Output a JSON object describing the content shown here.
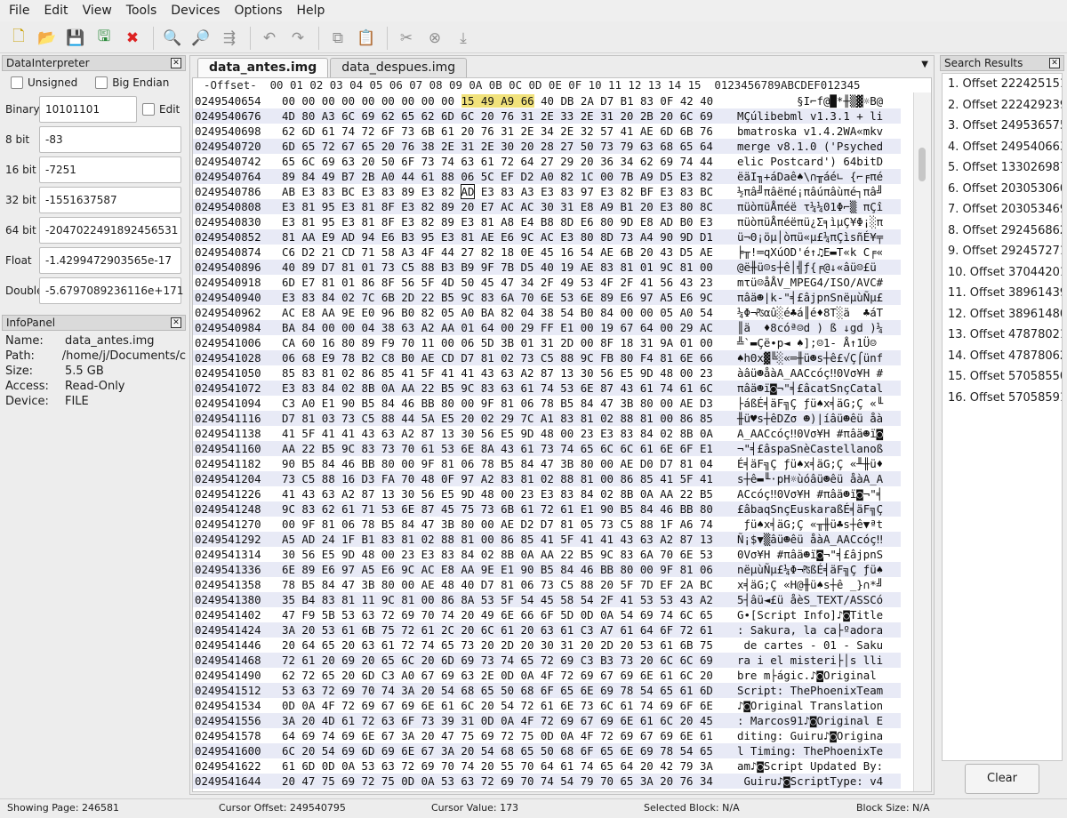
{
  "menu": [
    "File",
    "Edit",
    "View",
    "Tools",
    "Devices",
    "Options",
    "Help"
  ],
  "toolbar_icons": [
    "new-file-icon",
    "open-file-icon",
    "save-icon",
    "save-as-icon",
    "close-file-icon",
    "search-icon",
    "search-replace-icon",
    "goto-icon",
    "undo-icon",
    "redo-icon",
    "copy-icon",
    "paste-icon",
    "cut-icon",
    "delete-icon",
    "insert-icon"
  ],
  "data_interpreter": {
    "title": "DataInterpreter",
    "unsigned_label": "Unsigned",
    "big_endian_label": "Big Endian",
    "edit_label": "Edit",
    "binary_label": "Binary",
    "binary_value": "10101101",
    "bit8_label": "8 bit",
    "bit8_value": "-83",
    "bit16_label": "16 bit",
    "bit16_value": "-7251",
    "bit32_label": "32 bit",
    "bit32_value": "-1551637587",
    "bit64_label": "64 bit",
    "bit64_value": "-2047022491892456531",
    "float_label": "Float",
    "float_value": "-1.4299472903565e-17",
    "double_label": "Double",
    "double_value": "-5.6797089236116e+171"
  },
  "info_panel": {
    "title": "InfoPanel",
    "rows": [
      {
        "k": "Name:",
        "v": "data_antes.img"
      },
      {
        "k": "Path:",
        "v": "/home/j/Documents/c"
      },
      {
        "k": "Size:",
        "v": "5.5 GB"
      },
      {
        "k": "Access:",
        "v": "Read-Only"
      },
      {
        "k": "Device:",
        "v": "FILE"
      }
    ]
  },
  "tabs": [
    "data_antes.img",
    "data_despues.img"
  ],
  "hex": {
    "header": "-Offset-  00 01 02 03 04 05 06 07 08 09 0A 0B 0C 0D 0E 0F 10 11 12 13 14 15  0123456789ABCDEF012345",
    "rows": [
      {
        "o": "0249540654",
        "h": "00 00 00 00 00 00 00 00 00 15 49 A9 66 40 DB 2A D7 B1 83 0F 42 40",
        "a": "         §I⌐f@█*╫▒▓☼B@"
      },
      {
        "o": "0249540676",
        "h": "4D 80 A3 6C 69 62 65 62 6D 6C 20 76 31 2E 33 2E 31 20 2B 20 6C 69",
        "a": "MÇúlibebml v1.3.1 + li"
      },
      {
        "o": "0249540698",
        "h": "62 6D 61 74 72 6F 73 6B 61 20 76 31 2E 34 2E 32 57 41 AE 6D 6B 76",
        "a": "bmatroska v1.4.2WA«mkv"
      },
      {
        "o": "0249540720",
        "h": "6D 65 72 67 65 20 76 38 2E 31 2E 30 20 28 27 50 73 79 63 68 65 64",
        "a": "merge v8.1.0 ('Psyched"
      },
      {
        "o": "0249540742",
        "h": "65 6C 69 63 20 50 6F 73 74 63 61 72 64 27 29 20 36 34 62 69 74 44",
        "a": "elic Postcard') 64bitD"
      },
      {
        "o": "0249540764",
        "h": "89 84 49 B7 2B A0 44 61 88 06 5C EF D2 A0 82 1C 00 7B A9 D5 E3 82",
        "a": "ëäI╖+áDaê♠\\∩╥áé∟ {⌐╒πé"
      },
      {
        "o": "0249540786",
        "h": "AB E3 83 BC E3 83 89 E3 82 AD E3 83 A3 E3 83 97 E3 82 BF E3 83 BC",
        "a": "½πâ╝πâëπé¡πâúπâùπé┐πâ╝"
      },
      {
        "o": "0249540808",
        "h": "E3 81 95 E3 81 8F E3 82 89 20 E7 AC AC 30 31 E8 A9 B1 20 E3 80 8C",
        "a": "πüòπüÅπéë τ¼¼01Φ⌐▒ πÇî"
      },
      {
        "o": "0249540830",
        "h": "E3 81 95 E3 81 8F E3 82 89 E3 81 A8 E4 B8 8D E6 80 9D E8 AD B0 E3",
        "a": "πüòπüÅπéëπü¿Σ╕ìµÇ¥Φ¡░π"
      },
      {
        "o": "0249540852",
        "h": "81 AA E9 AD 94 E6 B3 95 E3 81 AE E6 9C AC E3 80 8D 73 A4 90 9D D1",
        "a": "ü¬Θ¡öµ│òπü«µ£¼πÇìsñÉ¥╤"
      },
      {
        "o": "0249540874",
        "h": "C6 D2 21 CD 71 58 A3 4F 44 27 82 18 0E 45 16 54 AE 6B 20 43 D5 AE",
        "a": "╞╥!═qXúOD'é↑♫E▬T«k C╒«"
      },
      {
        "o": "0249540896",
        "h": "40 89 D7 81 01 73 C5 88 B3 B9 9F 7B D5 40 19 AE 83 81 01 9C 81 00",
        "a": "@ë╫ü☺s┼ê│╣ƒ{╒@↓«âü☺£ü "
      },
      {
        "o": "0249540918",
        "h": "6D E7 81 01 86 8F 56 5F 4D 50 45 47 34 2F 49 53 4F 2F 41 56 43 23",
        "a": "mτü☺åÅV_MPEG4/ISO/AVC#"
      },
      {
        "o": "0249540940",
        "h": "E3 83 84 02 7C 6B 2D 22 B5 9C 83 6A 70 6E 53 6E 89 E6 97 A5 E6 9C",
        "a": "πâä☻|k-\"╡£âjpnSnëµùÑµ£"
      },
      {
        "o": "0249540962",
        "h": "AC E8 AA 9E E0 96 B0 82 05 A0 BA 82 04 38 54 B0 84 00 00 05 A0 54",
        "a": "¼Φ¬₧αû░é♣á║é♦8T░ä  ♣áT"
      },
      {
        "o": "0249540984",
        "h": "BA 84 00 00 04 38 63 A2 AA 01 64 00 29 FF E1 00 19 67 64 00 29 AC",
        "a": "║ä  ♦8cóª☺d ) ß ↓gd )¼"
      },
      {
        "o": "0249541006",
        "h": "CA 60 16 80 89 F9 70 11 00 06 5D 3B 01 31 2D 00 8F 18 31 9A 01 00",
        "a": "╩`▬Çë∙p◄ ♠];☺1- Å↑1Ü☺ "
      },
      {
        "o": "0249541028",
        "h": "06 68 E9 78 B2 C8 B0 AE CD D7 81 02 73 C5 88 9C FB 80 F4 81 6E 66",
        "a": "♠hΘx▓╚░«═╫ü☻s┼ê£√Ç⌠ünf"
      },
      {
        "o": "0249541050",
        "h": "85 83 81 02 86 85 41 5F 41 41 43 63 A2 87 13 30 56 E5 9D 48 00 23",
        "a": "àâü☻åàA_AACcóç‼0Vσ¥H #"
      },
      {
        "o": "0249541072",
        "h": "E3 83 84 02 8B 0A AA 22 B5 9C 83 63 61 74 53 6E 87 43 61 74 61 6C",
        "a": "πâä☻ï◙¬\"╡£âcatSnçCatal"
      },
      {
        "o": "0249541094",
        "h": "C3 A0 E1 90 B5 84 46 BB 80 00 9F 81 06 78 B5 84 47 3B 80 00 AE D3",
        "a": "├áßÉ╡äF╗Ç ƒü♠x╡äG;Ç «╙"
      },
      {
        "o": "0249541116",
        "h": "D7 81 03 73 C5 88 44 5A E5 20 02 29 7C A1 83 81 02 88 81 00 86 85",
        "a": "╫ü♥s┼êDZσ ☻)|íâü☻êü åà"
      },
      {
        "o": "0249541138",
        "h": "41 5F 41 41 43 63 A2 87 13 30 56 E5 9D 48 00 23 E3 83 84 02 8B 0A",
        "a": "A_AACcóç‼0Vσ¥H #πâä☻ï◙"
      },
      {
        "o": "0249541160",
        "h": "AA 22 B5 9C 83 73 70 61 53 6E 8A 43 61 73 74 65 6C 6C 61 6E 6F E1",
        "a": "¬\"╡£âspaSnèCastellanoß"
      },
      {
        "o": "0249541182",
        "h": "90 B5 84 46 BB 80 00 9F 81 06 78 B5 84 47 3B 80 00 AE D0 D7 81 04",
        "a": "É╡äF╗Ç ƒü♠x╡äG;Ç «╨╫ü♦"
      },
      {
        "o": "0249541204",
        "h": "73 C5 88 16 D3 FA 70 48 0F 97 A2 83 81 02 88 81 00 86 85 41 5F 41",
        "a": "s┼ê▬╙·pH☼ùóâü☻êü åàA_A"
      },
      {
        "o": "0249541226",
        "h": "41 43 63 A2 87 13 30 56 E5 9D 48 00 23 E3 83 84 02 8B 0A AA 22 B5",
        "a": "ACcóç‼0Vσ¥H #πâä☻ï◙¬\"╡"
      },
      {
        "o": "0249541248",
        "h": "9C 83 62 61 71 53 6E 87 45 75 73 6B 61 72 61 E1 90 B5 84 46 BB 80",
        "a": "£âbaqSnçEuskaraßÉ╡äF╗Ç"
      },
      {
        "o": "0249541270",
        "h": "00 9F 81 06 78 B5 84 47 3B 80 00 AE D2 D7 81 05 73 C5 88 1F A6 74",
        "a": " ƒü♠x╡äG;Ç «╥╫ü♣s┼ê▼ªt"
      },
      {
        "o": "0249541292",
        "h": "A5 AD 24 1F B1 83 81 02 88 81 00 86 85 41 5F 41 41 43 63 A2 87 13",
        "a": "Ñ¡$▼▒âü☻êü åàA_AACcóç‼"
      },
      {
        "o": "0249541314",
        "h": "30 56 E5 9D 48 00 23 E3 83 84 02 8B 0A AA 22 B5 9C 83 6A 70 6E 53",
        "a": "0Vσ¥H #πâä☻ï◙¬\"╡£âjpnS"
      },
      {
        "o": "0249541336",
        "h": "6E 89 E6 97 A5 E6 9C AC E8 AA 9E E1 90 B5 84 46 BB 80 00 9F 81 06",
        "a": "nëµùÑµ£¼Φ¬₧ßÉ╡äF╗Ç ƒü♠"
      },
      {
        "o": "0249541358",
        "h": "78 B5 84 47 3B 80 00 AE 48 40 D7 81 06 73 C5 88 20 5F 7D EF 2A BC",
        "a": "x╡äG;Ç «H@╫ü♠s┼ê _}∩*╝"
      },
      {
        "o": "0249541380",
        "h": "35 B4 83 81 11 9C 81 00 86 8A 53 5F 54 45 58 54 2F 41 53 53 43 A2",
        "a": "5┤âü◄£ü åèS_TEXT/ASSCó"
      },
      {
        "o": "0249541402",
        "h": "47 F9 5B 53 63 72 69 70 74 20 49 6E 66 6F 5D 0D 0A 54 69 74 6C 65",
        "a": "G∙[Script Info]♪◙Title"
      },
      {
        "o": "0249541424",
        "h": "3A 20 53 61 6B 75 72 61 2C 20 6C 61 20 63 61 C3 A7 61 64 6F 72 61",
        "a": ": Sakura, la ca├ºadora"
      },
      {
        "o": "0249541446",
        "h": "20 64 65 20 63 61 72 74 65 73 20 2D 20 30 31 20 2D 20 53 61 6B 75",
        "a": " de cartes - 01 - Saku"
      },
      {
        "o": "0249541468",
        "h": "72 61 20 69 20 65 6C 20 6D 69 73 74 65 72 69 C3 B3 73 20 6C 6C 69",
        "a": "ra i el misteri├│s lli"
      },
      {
        "o": "0249541490",
        "h": "62 72 65 20 6D C3 A0 67 69 63 2E 0D 0A 4F 72 69 67 69 6E 61 6C 20",
        "a": "bre m├ágic.♪◙Original "
      },
      {
        "o": "0249541512",
        "h": "53 63 72 69 70 74 3A 20 54 68 65 50 68 6F 65 6E 69 78 54 65 61 6D",
        "a": "Script: ThePhoenixTeam"
      },
      {
        "o": "0249541534",
        "h": "0D 0A 4F 72 69 67 69 6E 61 6C 20 54 72 61 6E 73 6C 61 74 69 6F 6E",
        "a": "♪◙Original Translation"
      },
      {
        "o": "0249541556",
        "h": "3A 20 4D 61 72 63 6F 73 39 31 0D 0A 4F 72 69 67 69 6E 61 6C 20 45",
        "a": ": Marcos91♪◙Original E"
      },
      {
        "o": "0249541578",
        "h": "64 69 74 69 6E 67 3A 20 47 75 69 72 75 0D 0A 4F 72 69 67 69 6E 61",
        "a": "diting: Guiru♪◙Origina"
      },
      {
        "o": "0249541600",
        "h": "6C 20 54 69 6D 69 6E 67 3A 20 54 68 65 50 68 6F 65 6E 69 78 54 65",
        "a": "l Timing: ThePhoenixTe"
      },
      {
        "o": "0249541622",
        "h": "61 6D 0D 0A 53 63 72 69 70 74 20 55 70 64 61 74 65 64 20 42 79 3A",
        "a": "am♪◙Script Updated By:"
      },
      {
        "o": "0249541644",
        "h": "20 47 75 69 72 75 0D 0A 53 63 72 69 70 74 54 79 70 65 3A 20 76 34",
        "a": " Guiru♪◙ScriptType: v4"
      }
    ]
  },
  "search_results": {
    "title": "Search Results",
    "items": [
      "1. Offset 222425151",
      "2. Offset 222429239",
      "3. Offset 249536575",
      "4. Offset 249540663",
      "5. Offset 133026987",
      "6. Offset 203053060",
      "7. Offset 203053469",
      "8. Offset 292456862",
      "9. Offset 292457271",
      "10. Offset 370442012",
      "11. Offset 389614393",
      "12. Offset 389614802",
      "13. Offset 478780212",
      "14. Offset 478780621",
      "15. Offset 570585507",
      "16. Offset 570585916"
    ],
    "clear_label": "Clear"
  },
  "status": {
    "page": "Showing Page: 246581",
    "cursor_offset": "Cursor Offset: 249540795",
    "cursor_value": "Cursor Value: 173",
    "selected_block": "Selected Block: N/A",
    "block_size": "Block Size: N/A"
  }
}
